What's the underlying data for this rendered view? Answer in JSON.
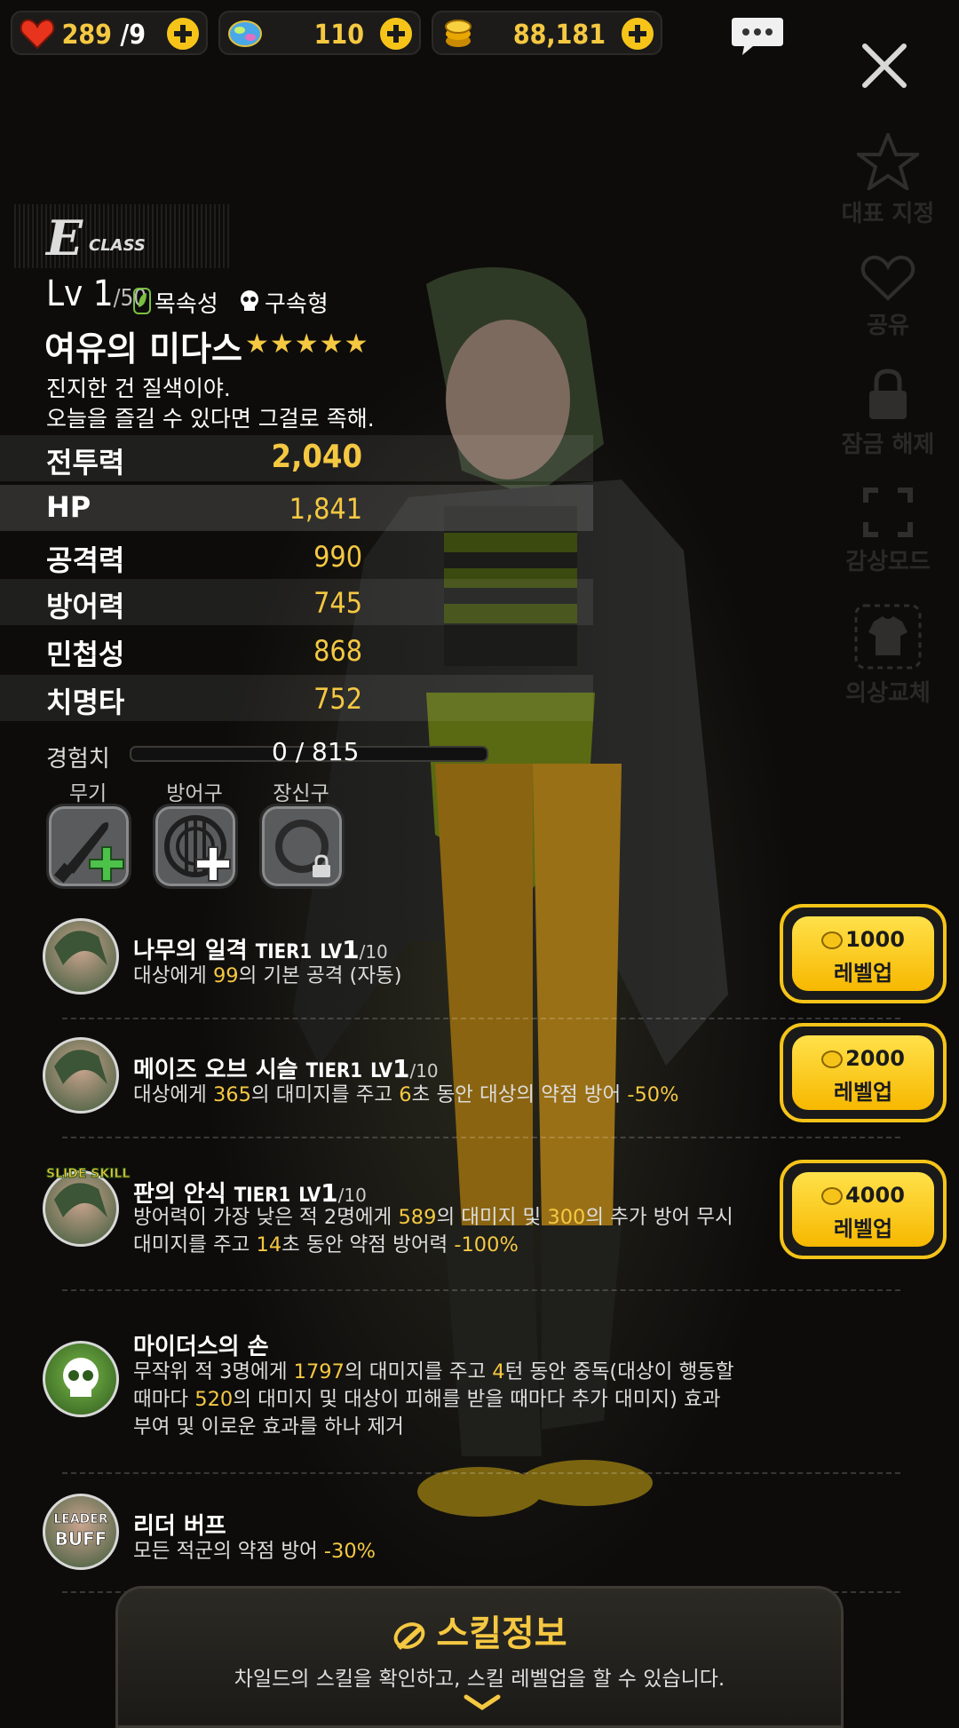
{
  "resources": {
    "hearts": "289",
    "hearts_max": "9",
    "gems": "110",
    "gold": "88,181"
  },
  "side_menu": {
    "representative": "대표 지정",
    "share": "공유",
    "unlock": "잠금 해제",
    "view_mode": "감상모드",
    "costume": "의상교체"
  },
  "character": {
    "class_letter": "E",
    "class_word": "CLASS",
    "level_prefix": "Lv ",
    "level": "1",
    "level_max": "/50",
    "element": "목속성",
    "type": "구속형",
    "name": "여유의 미다스",
    "stars": "★★★★★",
    "quote_line1": "진지한 건 질색이야.",
    "quote_line2": "오늘을 즐길 수 있다면 그걸로 족해."
  },
  "stats": [
    {
      "label": "전투력",
      "value": "2,040"
    },
    {
      "label": "HP",
      "value": "1,841"
    },
    {
      "label": "공격력",
      "value": "990"
    },
    {
      "label": "방어력",
      "value": "745"
    },
    {
      "label": "민첩성",
      "value": "868"
    },
    {
      "label": "치명타",
      "value": "752"
    }
  ],
  "experience": {
    "label": "경험치",
    "value": "0 / 815",
    "progress": 0
  },
  "equipment": {
    "weapon": "무기",
    "armor": "방어구",
    "accessory": "장신구"
  },
  "skills": [
    {
      "name": "나무의 일격",
      "tier": "TIER1",
      "lv_prefix": "LV",
      "lv": "1",
      "lv_max": "/10",
      "desc": [
        "대상에게 ",
        "99",
        "의 기본 공격 (자동)"
      ]
    },
    {
      "name": "메이즈 오브 시슬",
      "tier": "TIER1",
      "lv_prefix": "LV",
      "lv": "1",
      "lv_max": "/10",
      "desc": [
        "대상에게 ",
        "365",
        "의 대미지를 주고 ",
        "6",
        "초 동안 대상의 약점 방어 ",
        "-50%"
      ]
    },
    {
      "name": "판의 안식",
      "tier": "TIER1",
      "lv_prefix": "LV",
      "lv": "1",
      "lv_max": "/10",
      "badge": "SLIDE SKILL",
      "desc_line1": [
        "방어력이 가장 낮은 적 2명에게 ",
        "589",
        "의 대미지 및 ",
        "300",
        "의 추가 방어 무시"
      ],
      "desc_line2": [
        "대미지를 주고 ",
        "14",
        "초 동안 약점 방어력 ",
        "-100%"
      ]
    },
    {
      "name": "마이더스의 손",
      "desc_line1": [
        "무작위 적 3명에게 ",
        "1797",
        "의 대미지를 주고 ",
        "4",
        "턴 동안 중독(대상이 행동할"
      ],
      "desc_line2": [
        "때마다 ",
        "520",
        "의 대미지 및 대상이 피해를 받을 때마다 추가 대미지) 효과"
      ],
      "desc_line3": "부여 및 이로운 효과를 하나 제거"
    },
    {
      "name": "리더 버프",
      "badge_top": "LEADER",
      "badge_bottom": "BUFF",
      "desc": [
        "모든 적군의 약점 방어 ",
        "-30%"
      ]
    }
  ],
  "levelup_buttons": [
    {
      "cost": "1000",
      "label": "레벨업"
    },
    {
      "cost": "2000",
      "label": "레벨업"
    },
    {
      "cost": "4000",
      "label": "레벨업"
    }
  ],
  "skill_info": {
    "title": "스킬정보",
    "subtitle": "차일드의 스킬을 확인하고, 스킬 레벨업을 할 수 있습니다."
  },
  "colors": {
    "accent": "#f5c842",
    "button": "#f7c81e"
  }
}
